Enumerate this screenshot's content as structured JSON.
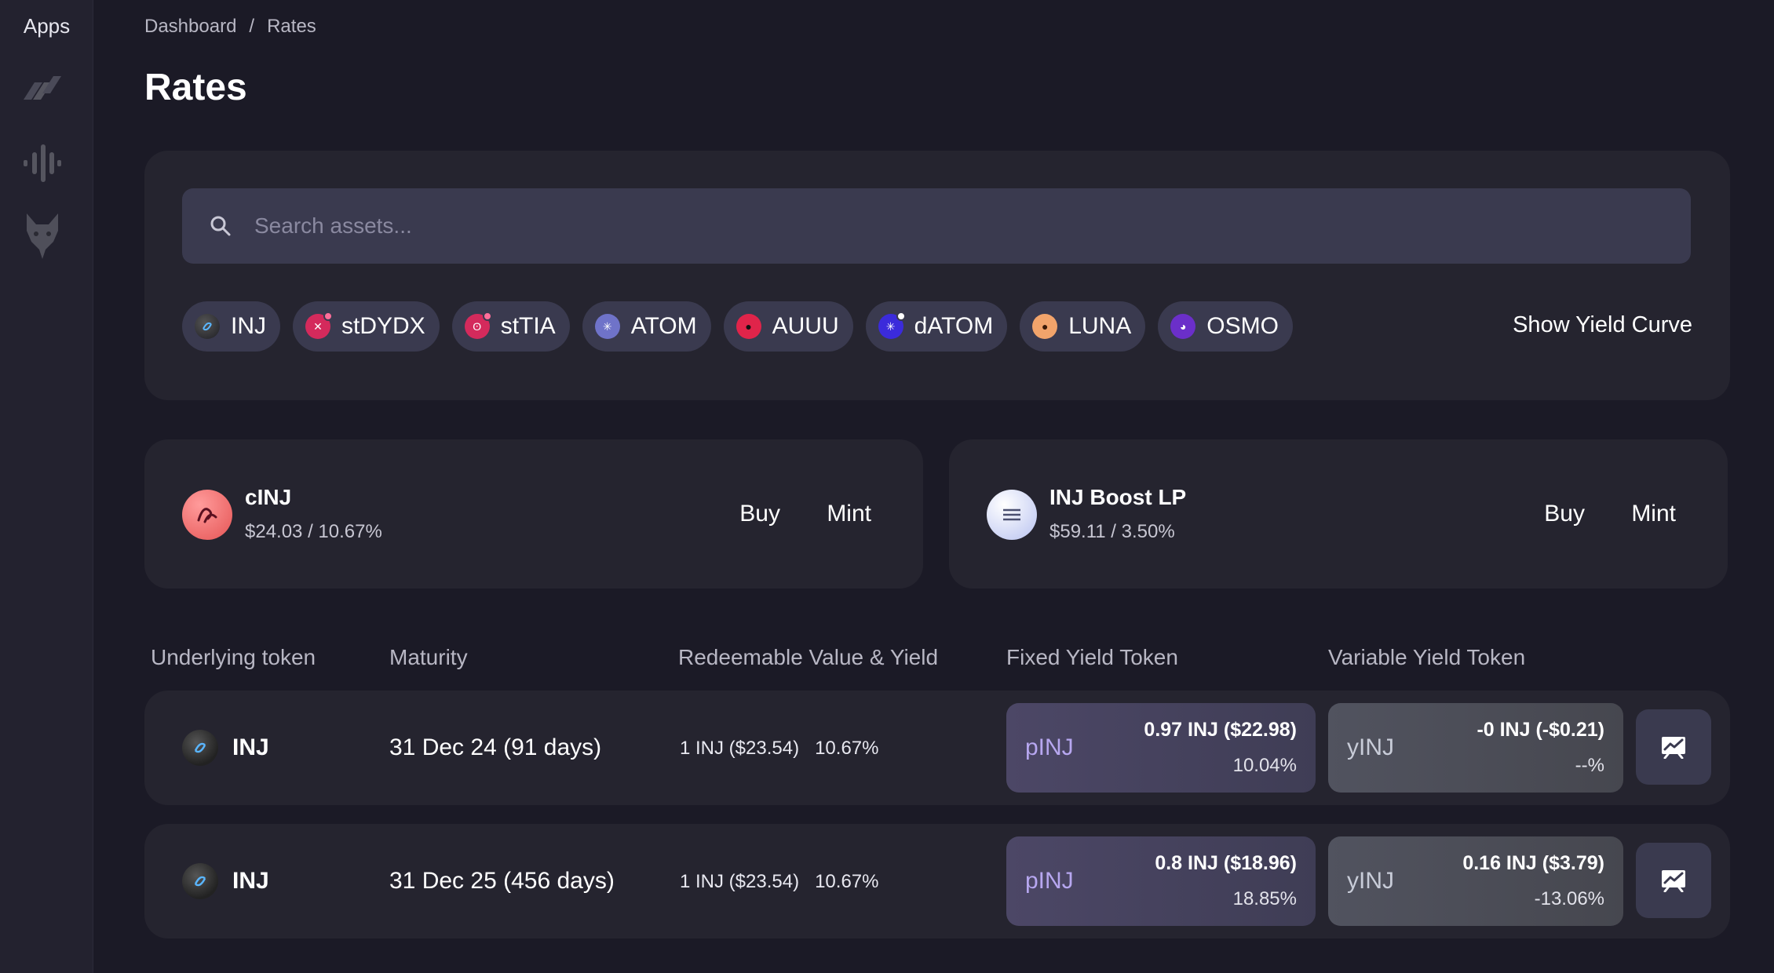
{
  "sidebar": {
    "title": "Apps",
    "items": [
      {
        "icon": "stripes-logo-icon"
      },
      {
        "icon": "waveform-icon"
      },
      {
        "icon": "wolf-icon"
      }
    ]
  },
  "breadcrumb": {
    "items": [
      "Dashboard",
      "Rates"
    ],
    "separator": "/"
  },
  "page_title": "Rates",
  "search": {
    "placeholder": "Search assets..."
  },
  "filters": {
    "chips": [
      {
        "label": "INJ",
        "icon": "inj-token-icon",
        "color": "#2a2a33"
      },
      {
        "label": "stDYDX",
        "icon": "stdydx-token-icon",
        "color": "#e0245e"
      },
      {
        "label": "stTIA",
        "icon": "sttia-token-icon",
        "color": "#e0245e"
      },
      {
        "label": "ATOM",
        "icon": "atom-token-icon",
        "color": "#6f73c9"
      },
      {
        "label": "AUUU",
        "icon": "auuu-token-icon",
        "color": "#e0244a"
      },
      {
        "label": "dATOM",
        "icon": "datom-token-icon",
        "color": "#3b2bdb"
      },
      {
        "label": "LUNA",
        "icon": "luna-token-icon",
        "color": "#f2a46b"
      },
      {
        "label": "OSMO",
        "icon": "osmo-token-icon",
        "color": "#6b2fc9"
      }
    ],
    "show_yield_curve": "Show Yield Curve"
  },
  "cards": [
    {
      "name": "cINJ",
      "price": "$24.03 / 10.67%",
      "buy": "Buy",
      "mint": "Mint",
      "icon": "cinj-token-icon",
      "color": "#f06a6a"
    },
    {
      "name": "INJ Boost LP",
      "price": "$59.11 / 3.50%",
      "buy": "Buy",
      "mint": "Mint",
      "icon": "lp-token-icon",
      "color": "#d9dcf7"
    }
  ],
  "table": {
    "headers": [
      "Underlying token",
      "Maturity",
      "Redeemable Value & Yield",
      "Fixed Yield Token",
      "Variable Yield Token"
    ],
    "rows": [
      {
        "token": "INJ",
        "maturity": "31 Dec 24 (91 days)",
        "redeem_value": "1 INJ ($23.54)",
        "redeem_yield": "10.67%",
        "pt": {
          "name": "pINJ",
          "amount": "0.97 INJ ($22.98)",
          "yield": "10.04%"
        },
        "yt": {
          "name": "yINJ",
          "amount": "-0 INJ (-$0.21)",
          "yield": "--%"
        }
      },
      {
        "token": "INJ",
        "maturity": "31 Dec 25 (456 days)",
        "redeem_value": "1 INJ ($23.54)",
        "redeem_yield": "10.67%",
        "pt": {
          "name": "pINJ",
          "amount": "0.8 INJ ($18.96)",
          "yield": "18.85%"
        },
        "yt": {
          "name": "yINJ",
          "amount": "0.16 INJ ($3.79)",
          "yield": "-13.06%"
        }
      }
    ]
  },
  "colors": {
    "background": "#1b1a26",
    "panel": "#25242f",
    "chip": "#3a3a4f",
    "accent_pt": "#b7a7f0"
  }
}
